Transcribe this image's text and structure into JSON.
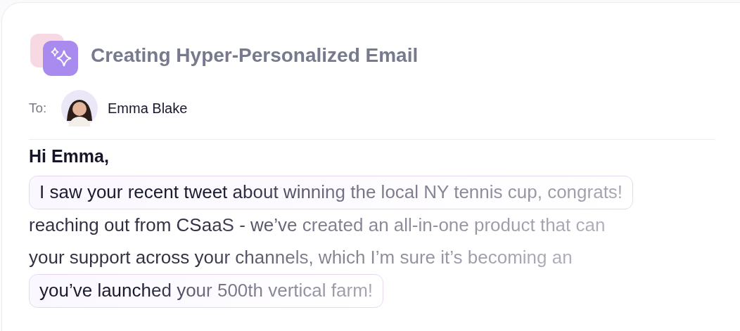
{
  "header": {
    "title": "Creating Hyper-Personalized Email"
  },
  "recipient": {
    "label": "To:",
    "name": "Emma Blake"
  },
  "email": {
    "greeting": "Hi Emma,",
    "lines": [
      {
        "kind": "highlight",
        "text": "I saw your recent tweet about winning the local NY tennis cup, congrats!"
      },
      {
        "kind": "plain",
        "text": "reaching out from CSaaS - we’ve created an all-in-one product that can"
      },
      {
        "kind": "plain",
        "text": "your support across your channels, which I’m sure it’s becoming an"
      },
      {
        "kind": "highlight",
        "text": "you’ve launched your 500th vertical farm!"
      }
    ]
  }
}
